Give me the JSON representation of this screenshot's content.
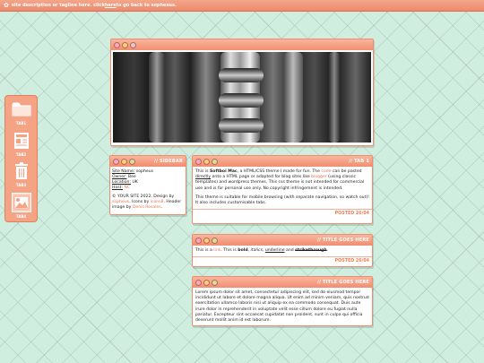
{
  "topbar": {
    "logo": "✿",
    "text_before": "site description or tagline here. click ",
    "link": "here",
    "text_after": " to go back to sophesus."
  },
  "sideicons": [
    {
      "label": "TAB1",
      "icon": "folder-icon"
    },
    {
      "label": "TAB2",
      "icon": "newspaper-icon"
    },
    {
      "label": "TAB3",
      "icon": "trash-icon"
    },
    {
      "label": "TAB4",
      "icon": "image-icon"
    }
  ],
  "sidebar": {
    "title": "// SIDEBAR",
    "site_name_label": "Site Name:",
    "site_name_value": " sopheus",
    "owner_label": "Owner:",
    "owner_value": " Bee",
    "location_label": "Location:",
    "location_value": " UK",
    "host_label": "Host:",
    "host_value": " NC",
    "credit_1": "© YOUR SITE 2022. Design by ",
    "credit_designer": "sopheus",
    "credit_2": ". Icons by ",
    "credit_icons": "icons8",
    "credit_3": ". Header image by ",
    "credit_photographer": "Denis Rosales",
    "credit_4": "."
  },
  "post1": {
    "title": "// TAB 1",
    "p1_a": "This is ",
    "p1_brand": "Softboi Mac",
    "p1_b": ", a HTML/CSS theme I made for fun. The ",
    "p1_code": "code",
    "p1_c": " can be pasted ",
    "p1_directly": "directly",
    "p1_d": " onto a HTML page or adapted for blog sites like ",
    "p1_blogger": "blogger",
    "p1_e": " (using classic templates) and wordpress themes. This css theme is not intended for commercial use and is for personal use only. No copyright infringement is intended.",
    "p2": "This theme is suitable for mobile browsing (with separate navigation, so watch out)! It also includes customisable tabs.",
    "posted": "POSTED 26/04"
  },
  "post2": {
    "title": "// TITLE GOES HERE",
    "a": "This is a ",
    "link": "link",
    "b": ". This is ",
    "bold": "bold",
    "c": ", ",
    "italics": "italics",
    "d": ", ",
    "underline": "underline",
    "e": " and ",
    "strike": "strikethrough",
    "f": ".",
    "posted": "POSTED 26/04"
  },
  "post3": {
    "title": "// TITLE GOES HERE",
    "text": "Lorem ipsum dolor sit amet, consectetur adipiscing elit, sed do eiusmod tempor incididunt ut labore et dolore magna aliqua. Ut enim ad minim veniam, quis nostrud exercitation ullamco laboris nisi ut aliquip ex ea commodo consequat. Duis aute irure dolor in reprehenderit in voluptate velit esse cillum dolore eu fugiat nulla pariatur. Excepteur sint occaecat cupidatat non proident, sunt in culpa qui officia deserunt mollit anim id est laborum."
  },
  "colors": {
    "accent": "#ef8d6f",
    "background": "#cfeee0",
    "link": "#e8784f"
  }
}
